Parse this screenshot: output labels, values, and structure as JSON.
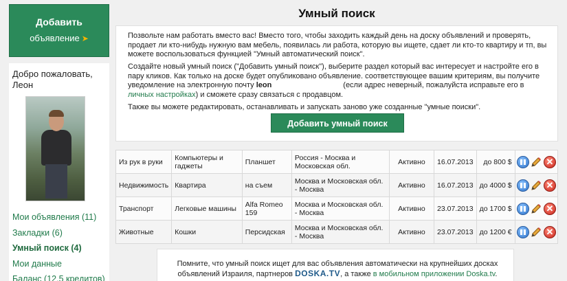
{
  "sidebar": {
    "add_button_line1": "Добавить",
    "add_button_line2": "объявление",
    "welcome": "Добро пожаловать, Леон",
    "menu": [
      {
        "label": "Мои объявления (11)",
        "active": false
      },
      {
        "label": "Закладки (6)",
        "active": false
      },
      {
        "label": "Умный поиск (4)",
        "active": true
      },
      {
        "label": "Мои данные",
        "active": false
      },
      {
        "label": "Баланс (12.5 кредитов)",
        "active": false
      }
    ]
  },
  "main": {
    "title": "Умный поиск",
    "p1": "Позвольте нам работать вместо вас! Вместо того, чтобы заходить каждый день на доску объявлений и проверять, продает ли кто-нибудь нужную вам мебель, появилась ли работа, которую вы ищете, сдает ли кто-то квартиру и тп, вы можете воспользоваться функцией \"Умный автоматический поиск\".",
    "p2_a": "Создайте новый умный поиск (\"Добавить умный поиск\"), выберите раздел который вас интересует и настройте его в пару кликов. Как только на доске будет опубликовано объявление. соответствующее вашим критериям, вы получите уведомление на электронную почту",
    "p2_email": "leon",
    "p2_b": "(если адрес неверный, пожалуйста исправьте его в",
    "p2_link": "личных настройках",
    "p2_c": ") и сможете сразу связаться с продавцом.",
    "p3": "Также вы можете редактировать, останавливать и запускать заново уже созданные \"умные поиски\".",
    "add_search_button": "Добавить умный поиск"
  },
  "searches": [
    {
      "category": "Из рук в руки",
      "subcategory": "Компьютеры и гаджеты",
      "type": "Планшет",
      "location": "Россия - Москва и Московская обл.",
      "status": "Активно",
      "date": "16.07.2013",
      "price": "до 800 $"
    },
    {
      "category": "Недвижимость",
      "subcategory": "Квартира",
      "type": "на съем",
      "location": "Москва и Московская обл. - Москва",
      "status": "Активно",
      "date": "16.07.2013",
      "price": "до 4000 $"
    },
    {
      "category": "Транспорт",
      "subcategory": "Легковые машины",
      "type": "Alfa Romeo 159",
      "location": "Москва и Московская обл. - Москва",
      "status": "Активно",
      "date": "23.07.2013",
      "price": "до 1700 $"
    },
    {
      "category": "Животные",
      "subcategory": "Кошки",
      "type": "Персидская",
      "location": "Москва и Московская обл. - Москва",
      "status": "Активно",
      "date": "23.07.2013",
      "price": "до 1200 €"
    }
  ],
  "footer": {
    "text_a": "Помните, что умный поиск ищет для вас объявления автоматически на крупнейших досках объявлений Израиля, партнеров",
    "logo": "DOSKA.TV",
    "text_b": ", а также",
    "link": "в мобильном приложении Doska.tv",
    "text_c": "."
  },
  "colors": {
    "accent": "#2b8a5a",
    "link": "#1f7a4a"
  }
}
